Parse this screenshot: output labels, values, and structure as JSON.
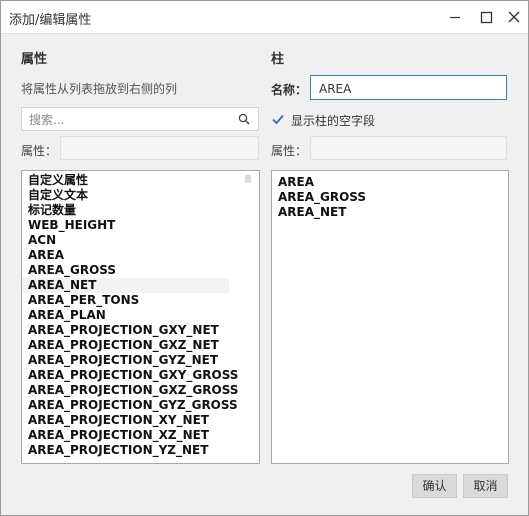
{
  "window": {
    "title": "添加/编辑属性"
  },
  "left": {
    "header": "属性",
    "hint": "将属性从列表拖放到右侧的列",
    "search_placeholder": "搜索...",
    "property_label": "属性：",
    "items": [
      "自定义属性",
      "自定义文本",
      "标记数量",
      "WEB_HEIGHT",
      "ACN",
      "AREA",
      "AREA_GROSS",
      "AREA_NET",
      "AREA_PER_TONS",
      "AREA_PLAN",
      "AREA_PROJECTION_GXY_NET",
      "AREA_PROJECTION_GXZ_NET",
      "AREA_PROJECTION_GYZ_NET",
      "AREA_PROJECTION_GXY_GROSS",
      "AREA_PROJECTION_GXZ_GROSS",
      "AREA_PROJECTION_GYZ_GROSS",
      "AREA_PROJECTION_XY_NET",
      "AREA_PROJECTION_XZ_NET",
      "AREA_PROJECTION_YZ_NET"
    ]
  },
  "right": {
    "header": "柱",
    "name_label": "名称：",
    "name_value": "AREA",
    "checkbox_label": "显示柱的空字段",
    "checkbox_checked": true,
    "property_label": "属性：",
    "items": [
      "AREA",
      "AREA_GROSS",
      "AREA_NET"
    ]
  },
  "buttons": {
    "ok": "确认",
    "cancel": "取消"
  },
  "colors": {
    "accent": "#2f6fc0",
    "focus_border": "#3d7cc9"
  }
}
